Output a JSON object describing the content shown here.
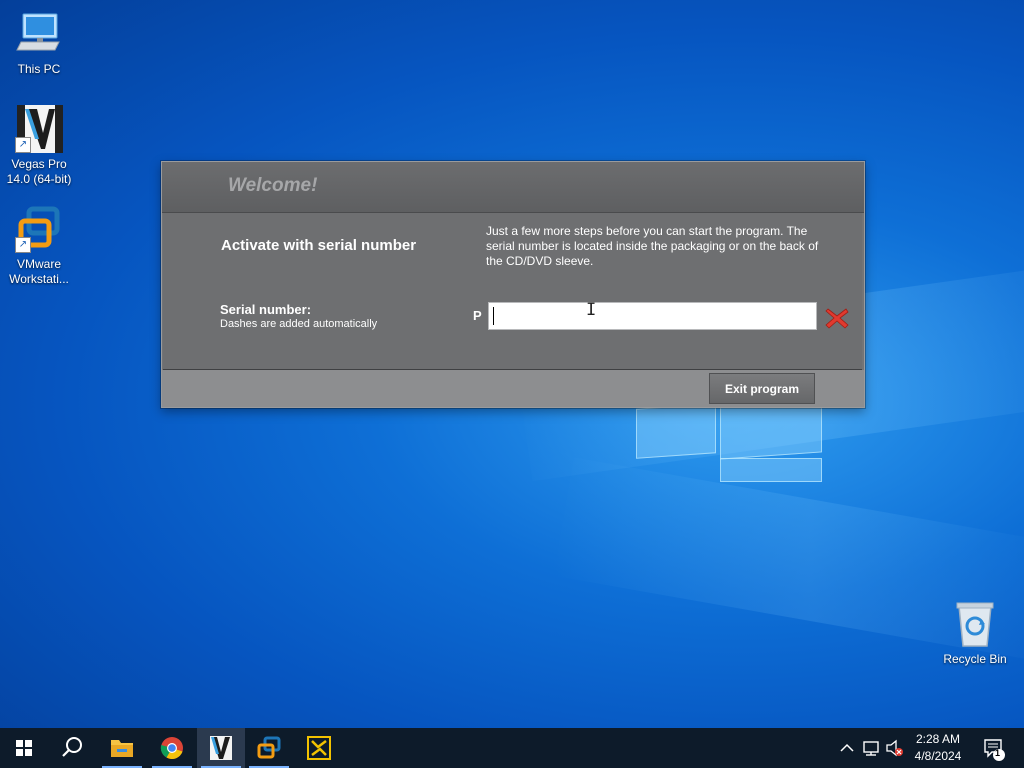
{
  "desktop": {
    "icons": [
      {
        "label": "This PC",
        "icon": "this-pc-icon"
      },
      {
        "label": "Vegas Pro 14.0 (64-bit)",
        "icon": "vegas-pro-icon"
      },
      {
        "label": "VMware Workstati...",
        "icon": "vmware-icon"
      },
      {
        "label": "Recycle Bin",
        "icon": "recycle-bin-icon"
      }
    ]
  },
  "dialog": {
    "title": "Welcome!",
    "heading": "Activate with serial number",
    "instructions": "Just a few more steps before you can start the program. The serial number is located inside the packaging or on the back of the CD/DVD sleeve.",
    "serial_label": "Serial number:",
    "serial_hint": "Dashes are added automatically",
    "serial_prefix": "P",
    "serial_value": "",
    "exit_label": "Exit program",
    "colors": {
      "panel": "#6e6f71",
      "header": "#5e5f61",
      "footer": "#8d8e90",
      "clear": "#e03a2f"
    }
  },
  "taskbar": {
    "items": [
      "start-icon",
      "search-icon",
      "file-explorer-icon",
      "chrome-icon",
      "vegas-pro-icon",
      "vmware-icon",
      "network-app-icon"
    ],
    "tray_icons": [
      "chevron-up-icon",
      "network-icon",
      "volume-muted-icon"
    ],
    "time": "2:28 AM",
    "date": "4/8/2024",
    "notifications": "1"
  }
}
